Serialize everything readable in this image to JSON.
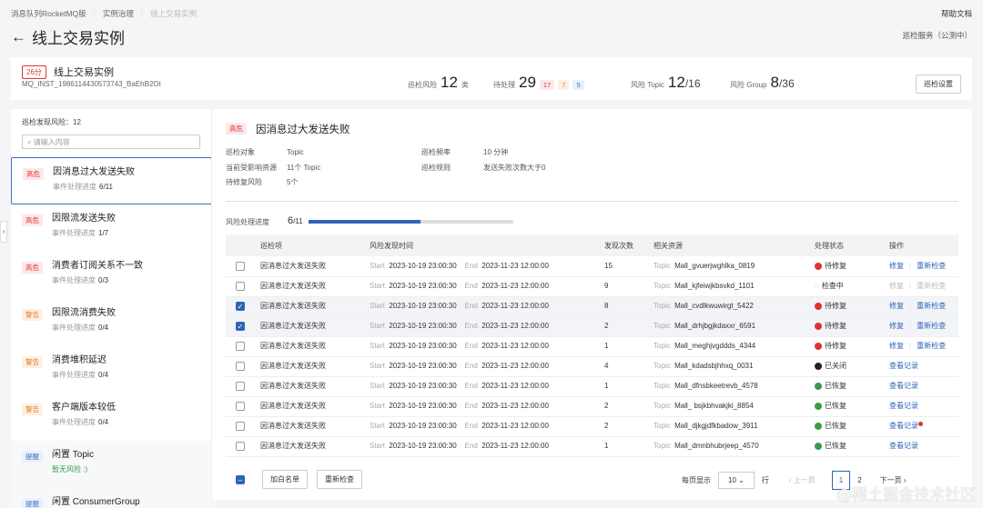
{
  "breadcrumb": [
    "消息队列RocketMQ版",
    "实例治理",
    "线上交易实例"
  ],
  "help": "帮助文档",
  "title": "线上交易实例",
  "service": "巡检服务（公测中）",
  "instance": {
    "score": "26分",
    "name": "线上交易实例",
    "id": "MQ_INST_1986114430573743_BaEhB2OI"
  },
  "stats": {
    "risk_label": "巡检风险",
    "risk_value": "12",
    "risk_unit": "类",
    "pending_label": "待处理",
    "pending_value": "29",
    "pending_high": "17",
    "pending_warn": "7",
    "pending_tip": "5",
    "topic_label": "风险 Topic",
    "topic_value": "12",
    "topic_total": "/16",
    "group_label": "风险 Group",
    "group_value": "8",
    "group_total": "/36",
    "settings": "巡检设置"
  },
  "sidebar": {
    "count_label": "巡检发现风险：12",
    "search_placeholder": "请输入内容",
    "progress_label": "事件处理进度",
    "items": [
      {
        "tag": "高危",
        "level": "hi",
        "name": "因消息过大发送失败",
        "progress": "6/11"
      },
      {
        "tag": "高危",
        "level": "hi",
        "name": "因限流发送失败",
        "progress": "1/7"
      },
      {
        "tag": "高危",
        "level": "hi",
        "name": "消费者订阅关系不一致",
        "progress": "0/3"
      },
      {
        "tag": "警告",
        "level": "warn",
        "name": "因限流消费失败",
        "progress": "0/4"
      },
      {
        "tag": "警告",
        "level": "warn",
        "name": "消费堆积延迟",
        "progress": "0/4"
      },
      {
        "tag": "警告",
        "level": "warn",
        "name": "客户端版本较低",
        "progress": "0/4"
      },
      {
        "tag": "提醒",
        "level": "tip",
        "name": "闲置 Topic",
        "progress": "暂无风险 :)"
      },
      {
        "tag": "提醒",
        "level": "tip",
        "name": "闲置 ConsumerGroup",
        "progress": ""
      }
    ]
  },
  "detail": {
    "tag": "高危",
    "title": "因消息过大发送失败",
    "fields": [
      {
        "k": "巡检对象",
        "v": "Topic"
      },
      {
        "k": "当前受影响资源",
        "v": "11个 Topic"
      },
      {
        "k": "待修复风险",
        "v": "5个"
      },
      {
        "k": "巡检频率",
        "v": "10 分钟"
      },
      {
        "k": "巡检规则",
        "v": "发送失败次数大于0"
      }
    ],
    "progress_label": "风险处理进度",
    "progress_done": "6",
    "progress_total": "/11",
    "progress_fraction": 0.545
  },
  "table": {
    "headers": [
      "巡检项",
      "风险发现时间",
      "发现次数",
      "相关资源",
      "处理状态",
      "操作"
    ],
    "rows": [
      {
        "checked": false,
        "item": "因消息过大发送失败",
        "start": "2023-10-19 23:00:30",
        "end": "2023-11-23 12:00:00",
        "count": "15",
        "res": "Mall_gvuerjwghlka_0819",
        "status": "待修复",
        "st": "red",
        "a1": "修复",
        "a2": "重新检查"
      },
      {
        "checked": false,
        "item": "因消息过大发送失败",
        "start": "2023-10-19 23:00:30",
        "end": "2023-11-23 12:00:00",
        "count": "9",
        "res": "Mall_kjfeiwjkbsvkd_1101",
        "status": "检查中",
        "st": "spin",
        "a1": "修复",
        "a2": "重新检查"
      },
      {
        "checked": true,
        "item": "因消息过大发送失败",
        "start": "2023-10-19 23:00:30",
        "end": "2023-11-23 12:00:00",
        "count": "8",
        "res": "Mall_cvdlkwuwirgt_5422",
        "status": "待修复",
        "st": "red",
        "a1": "修复",
        "a2": "重新检查"
      },
      {
        "checked": true,
        "item": "因消息过大发送失败",
        "start": "2023-10-19 23:00:30",
        "end": "2023-11-23 12:00:00",
        "count": "2",
        "res": "Mall_drhjbgjkdaxxr_6591",
        "status": "待修复",
        "st": "red",
        "a1": "修复",
        "a2": "重新检查"
      },
      {
        "checked": false,
        "item": "因消息过大发送失败",
        "start": "2023-10-19 23:00:30",
        "end": "2023-11-23 12:00:00",
        "count": "1",
        "res": "Mall_meghjvgddds_4344",
        "status": "待修复",
        "st": "red",
        "a1": "修复",
        "a2": "重新检查"
      },
      {
        "checked": false,
        "item": "因消息过大发送失败",
        "start": "2023-10-19 23:00:30",
        "end": "2023-11-23 12:00:00",
        "count": "4",
        "res": "Mall_kdadsbjhhxq_0031",
        "status": "已关闭",
        "st": "black",
        "a1": "查看记录",
        "a2": ""
      },
      {
        "checked": false,
        "item": "因消息过大发送失败",
        "start": "2023-10-19 23:00:30",
        "end": "2023-11-23 12:00:00",
        "count": "1",
        "res": "Mall_dfnsbkeetrevb_4578",
        "status": "已恢复",
        "st": "green",
        "a1": "查看记录",
        "a2": ""
      },
      {
        "checked": false,
        "item": "因消息过大发送失败",
        "start": "2023-10-19 23:00:30",
        "end": "2023-11-23 12:00:00",
        "count": "2",
        "res": "Mall_ bsjkbhvakjki_8854",
        "status": "已恢复",
        "st": "green",
        "a1": "查看记录",
        "a2": ""
      },
      {
        "checked": false,
        "item": "因消息过大发送失败",
        "start": "2023-10-19 23:00:30",
        "end": "2023-11-23 12:00:00",
        "count": "2",
        "res": "Mall_djkgjdfkbadow_3911",
        "status": "已恢复",
        "st": "green",
        "a1": "查看记录",
        "a2": "",
        "badge": true
      },
      {
        "checked": false,
        "item": "因消息过大发送失败",
        "start": "2023-10-19 23:00:30",
        "end": "2023-11-23 12:00:00",
        "count": "1",
        "res": "Mall_dmnbhubrjeep_4570",
        "status": "已恢复",
        "st": "green",
        "a1": "查看记录",
        "a2": ""
      }
    ],
    "start_label": "Start",
    "end_label": "End",
    "res_type": "Topic"
  },
  "footer": {
    "whitelist": "加白名单",
    "recheck": "重新检查",
    "per_page_label": "每页显示",
    "per_page": "10",
    "rows_unit": "行",
    "prev": "上一页",
    "pages": [
      "1",
      "2"
    ],
    "next": "下一页"
  },
  "watermark": "@稀土掘金技术社区",
  "colors": {
    "accent": "#2f64b8",
    "danger": "#d33",
    "warn": "#e07a1e",
    "ok": "#3a9b4a"
  }
}
